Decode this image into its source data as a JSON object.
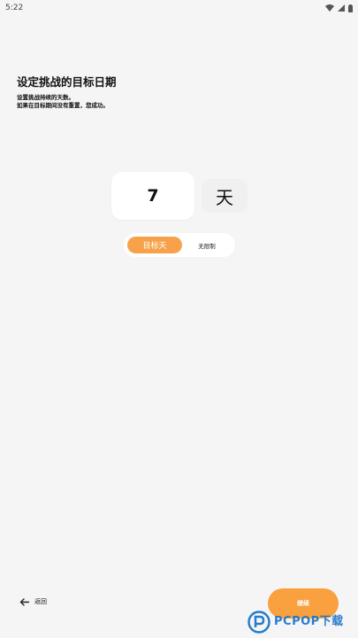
{
  "status_bar": {
    "time": "5:22"
  },
  "header": {
    "title": "设定挑战的目标日期",
    "line1": "设置挑战持续的天数。",
    "line2": "如果在目标期间没有重置，您成功。"
  },
  "picker": {
    "value": "7",
    "unit": "天"
  },
  "mode_toggle": {
    "options": [
      "目标天",
      "无限制"
    ],
    "selected": "目标天"
  },
  "footer": {
    "back_label": "返回",
    "continue_label": "继续"
  },
  "watermark": {
    "text": "PCPOP下载"
  },
  "colors": {
    "accent": "#f9a03f",
    "background": "#f5f5f5",
    "watermark_blue": "#1d76c9"
  }
}
